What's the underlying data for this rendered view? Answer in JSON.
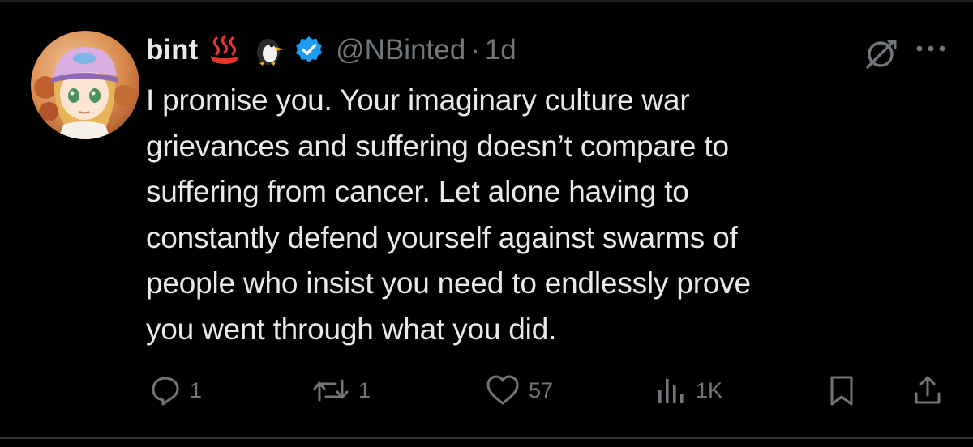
{
  "author": {
    "display_name": "bint",
    "handle": "@NBinted",
    "separator": "·",
    "timestamp": "1d",
    "name_emojis": [
      "hot-springs-emoji",
      "penguin-emoji"
    ],
    "verified_badge": "verified-badge-icon"
  },
  "tweet": {
    "lines": [
      "I promise you. Your imaginary culture war",
      "grievances and suffering doesn’t compare to",
      "suffering from cancer. Let alone having to",
      "constantly defend yourself against swarms of",
      "people who insist you need to endlessly prove",
      "you went through what you did."
    ]
  },
  "actions": {
    "reply": {
      "icon": "reply-icon",
      "count": "1"
    },
    "retweet": {
      "icon": "retweet-icon",
      "count": "1"
    },
    "like": {
      "icon": "heart-icon",
      "count": "57"
    },
    "views": {
      "icon": "analytics-icon",
      "count": "1K"
    },
    "bookmark": {
      "icon": "bookmark-icon"
    },
    "share": {
      "icon": "share-icon"
    }
  },
  "header_icons": [
    "grok-icon",
    "more-icon"
  ],
  "colors": {
    "background": "#000000",
    "text_primary": "#e7e9ea",
    "text_secondary": "#71767b",
    "verified_blue": "#1d9bf0"
  }
}
